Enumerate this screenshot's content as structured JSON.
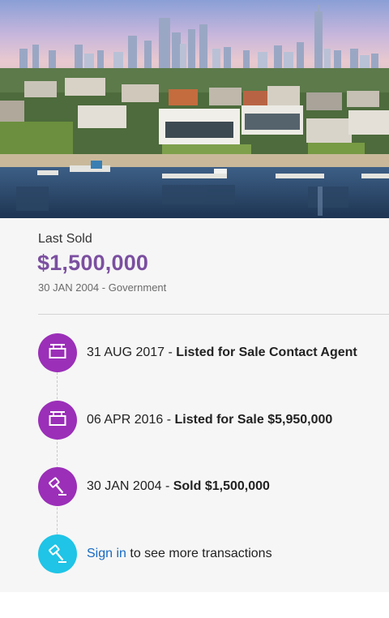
{
  "last_sold": {
    "label": "Last Sold",
    "price": "$1,500,000",
    "date": "30 JAN 2004",
    "separator": " - ",
    "source": "Government"
  },
  "timeline": [
    {
      "date": "31 AUG 2017",
      "separator": " - ",
      "description": "Listed for Sale Contact Agent",
      "icon": "for-sale-sign-icon",
      "color": "#9b2fb8"
    },
    {
      "date": "06 APR 2016",
      "separator": " - ",
      "description": "Listed for Sale $5,950,000",
      "icon": "for-sale-sign-icon",
      "color": "#9b2fb8"
    },
    {
      "date": "30 JAN 2004",
      "separator": " - ",
      "description": "Sold $1,500,000",
      "icon": "gavel-icon",
      "color": "#9b2fb8"
    }
  ],
  "signin": {
    "link_label": "Sign in",
    "rest": " to see more transactions",
    "icon": "gavel-icon",
    "color": "#1fc4e6"
  },
  "colors": {
    "price": "#7b4fa0",
    "link": "#1769c2"
  }
}
